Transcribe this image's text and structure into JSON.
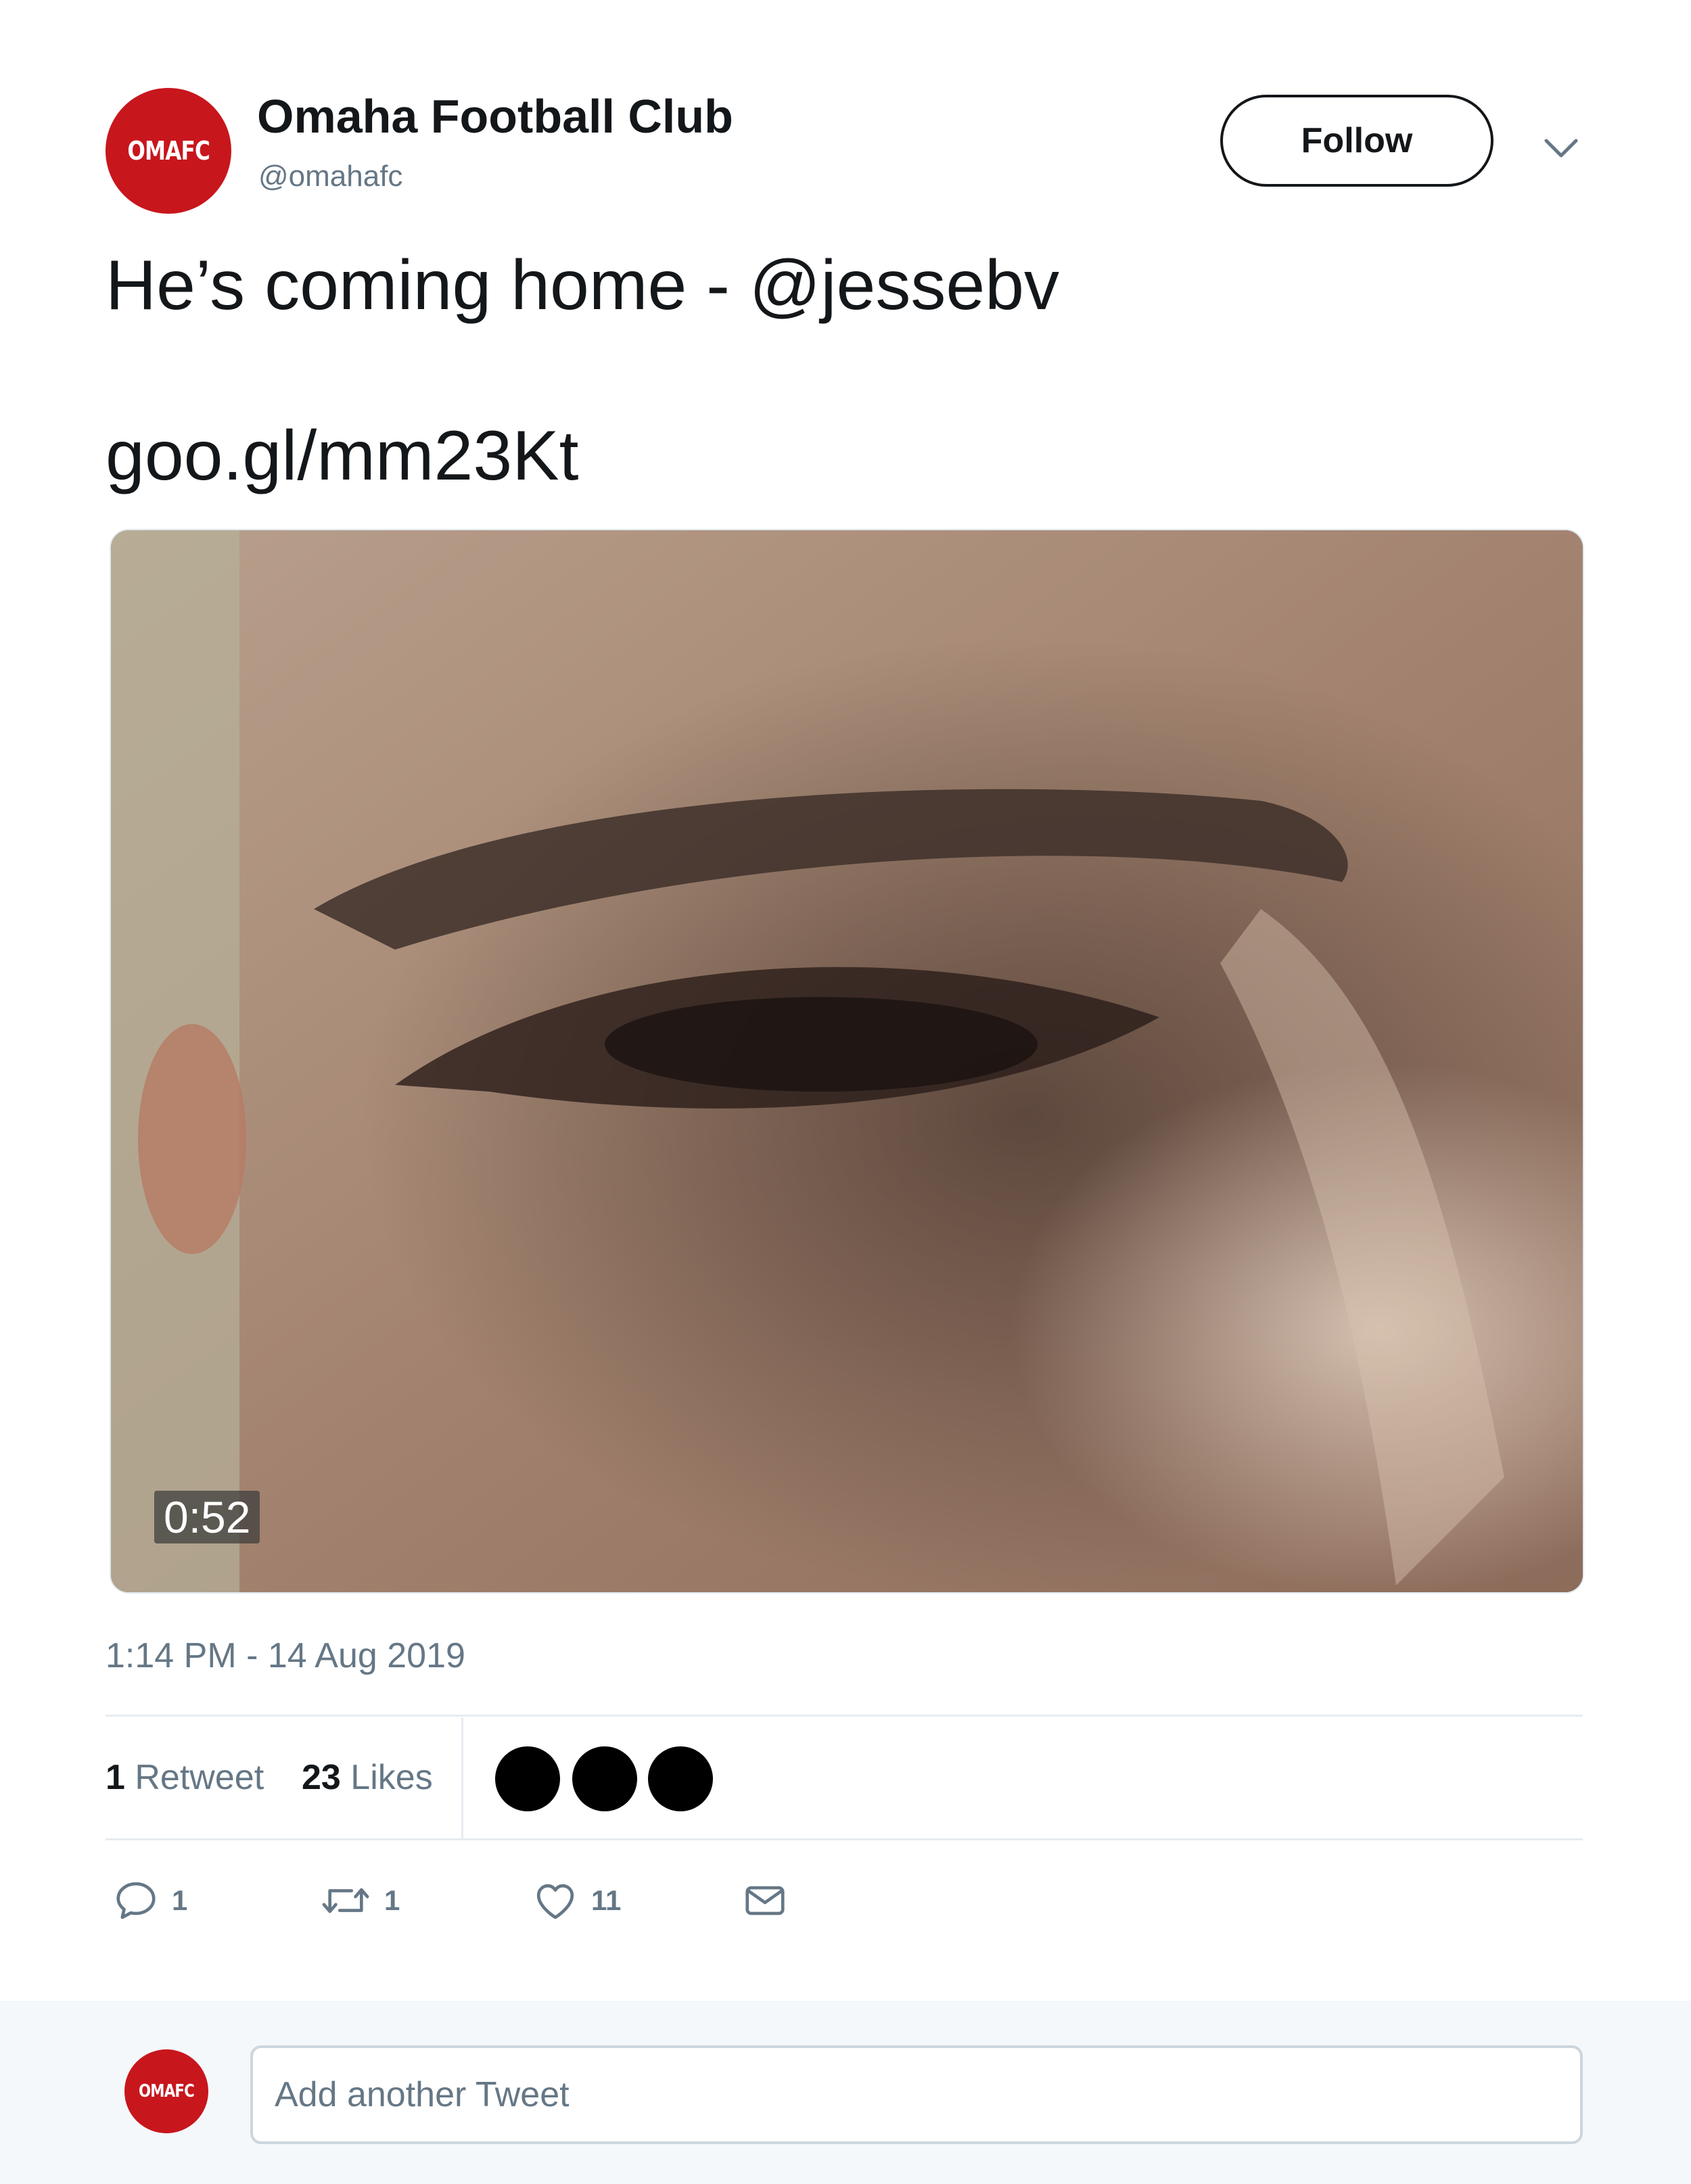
{
  "account": {
    "avatar_text": "OMAFC",
    "display_name": "Omaha Football Club",
    "handle": "@omahafc",
    "brand_color": "#c8161d"
  },
  "header": {
    "follow_label": "Follow",
    "menu_icon": "chevron-down-icon"
  },
  "tweet": {
    "text": "He’s coming home - @jessebv",
    "link": "goo.gl/mm23Kt",
    "video_duration": "0:52",
    "timestamp": "1:14 PM - 14 Aug 2019"
  },
  "stats": {
    "retweets_count": "1",
    "retweets_label": "Retweet",
    "likes_count": "23",
    "likes_label": "Likes"
  },
  "actions": {
    "reply_count": "1",
    "retweet_count": "1",
    "like_count": "11"
  },
  "reply": {
    "avatar_text": "OMAFC",
    "placeholder": "Add another Tweet"
  },
  "colors": {
    "text_primary": "#14171a",
    "text_secondary": "#657786",
    "divider": "#e6ecf0",
    "reply_bg": "#f5f8fa"
  }
}
